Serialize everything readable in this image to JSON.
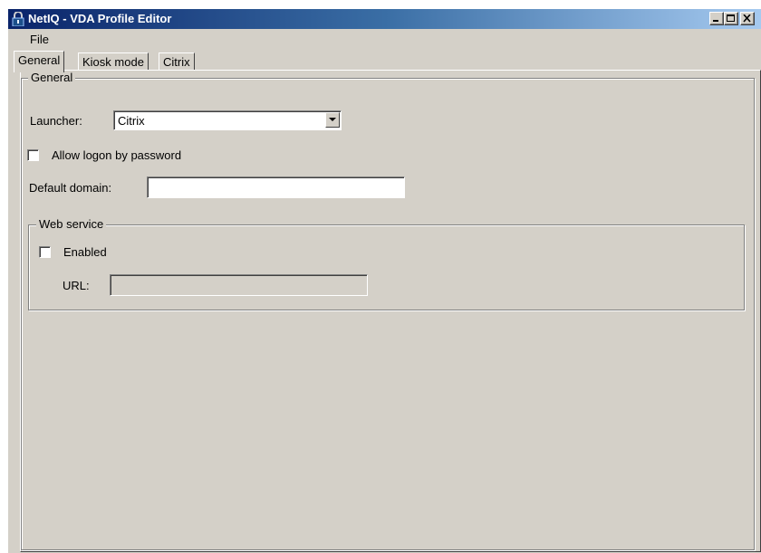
{
  "window": {
    "title": "NetIQ - VDA Profile Editor",
    "icon": "lock-icon",
    "controls": [
      "minimize",
      "maximize",
      "close"
    ]
  },
  "menu": {
    "file": "File"
  },
  "tabs": [
    {
      "label": "General",
      "active": true
    },
    {
      "label": "Kiosk mode",
      "active": false
    },
    {
      "label": "Citrix",
      "active": false
    }
  ],
  "general": {
    "group_label": "General",
    "launcher_label": "Launcher:",
    "launcher_value": "Citrix",
    "allow_logon_label": "Allow logon by password",
    "allow_logon_checked": false,
    "default_domain_label": "Default domain:",
    "default_domain_value": ""
  },
  "web_service": {
    "group_label": "Web service",
    "enabled_label": "Enabled",
    "enabled_checked": false,
    "url_label": "URL:",
    "url_value": ""
  }
}
